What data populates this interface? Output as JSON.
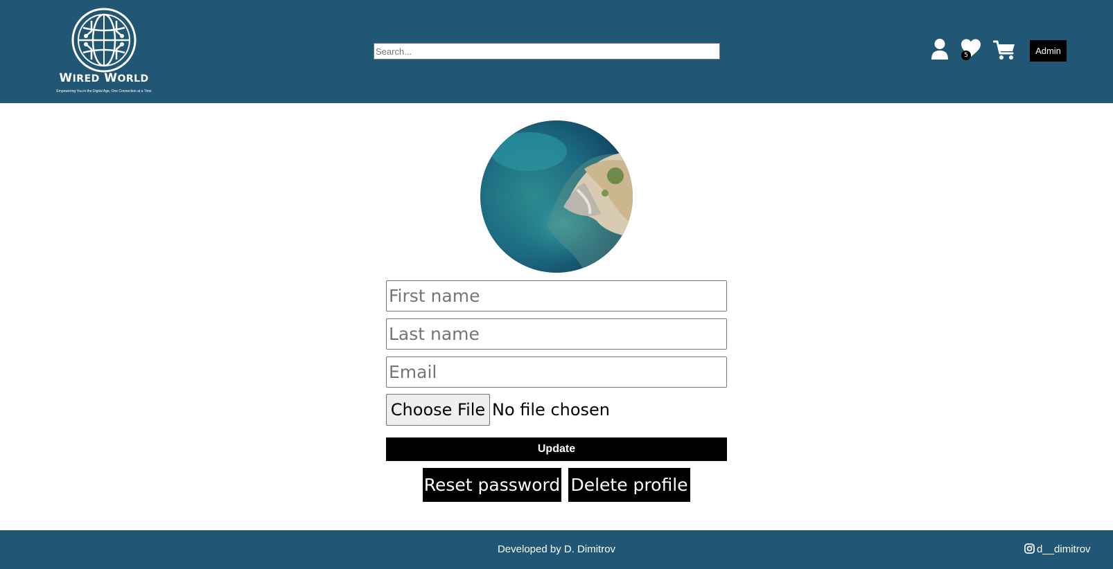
{
  "header": {
    "logo": {
      "title_first_letter": "W",
      "title_first_rest": "IRED",
      "title_second_letter": "W",
      "title_second_rest": "ORLD",
      "tagline": "Empowering You in the Digital Age, One Connection at a Time"
    },
    "search": {
      "placeholder": "Search...",
      "value": ""
    },
    "icons": {
      "profile": "user-icon",
      "wishlist": "heart-icon",
      "cart": "cart-icon"
    },
    "wishlist_count": "5",
    "admin_label": "Admin"
  },
  "profile_form": {
    "avatar": "profile-photo-coastline",
    "first_name": {
      "placeholder": "First name",
      "value": ""
    },
    "last_name": {
      "placeholder": "Last name",
      "value": ""
    },
    "email": {
      "placeholder": "Email",
      "value": ""
    },
    "file_button_label": "Choose File",
    "file_status": "No file chosen",
    "update_label": "Update",
    "reset_password_label": "Reset password",
    "delete_profile_label": "Delete profile"
  },
  "footer": {
    "credit": "Developed by D. Dimitrov",
    "social_icon": "instagram-icon",
    "social_handle": "d__dimitrov"
  },
  "colors": {
    "header_bg": "#215675",
    "footer_bg": "#215675",
    "button_bg": "#000000",
    "text_on_dark": "#ffffff"
  }
}
